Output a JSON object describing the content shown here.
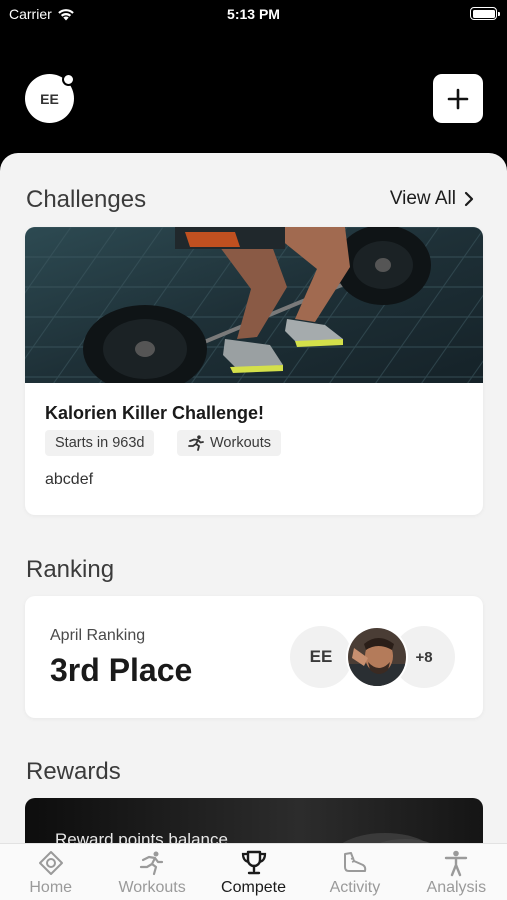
{
  "status_bar": {
    "carrier": "Carrier",
    "time": "5:13 PM"
  },
  "header": {
    "avatar_initials": "EE"
  },
  "challenges": {
    "title": "Challenges",
    "view_all": "View All",
    "card": {
      "title": "Kalorien Killer Challenge!",
      "chip_start": "Starts in 963d",
      "chip_type": "Workouts",
      "description": "abcdef"
    }
  },
  "ranking": {
    "title": "Ranking",
    "label": "April Ranking",
    "value": "3rd Place",
    "avatar_initials": "EE",
    "more_count": "+8"
  },
  "rewards": {
    "title": "Rewards",
    "balance_label": "Reward points balance"
  },
  "tab_bar": {
    "items": [
      {
        "label": "Home",
        "icon": "home-icon"
      },
      {
        "label": "Workouts",
        "icon": "running-icon"
      },
      {
        "label": "Compete",
        "icon": "trophy-icon"
      },
      {
        "label": "Activity",
        "icon": "shoe-icon"
      },
      {
        "label": "Analysis",
        "icon": "person-icon"
      }
    ],
    "active": "Compete"
  },
  "colors": {
    "header_bg": "#000000",
    "sheet_bg": "#f3f3f3",
    "active_tab": "#1a1a1a",
    "inactive_tab": "#9a9a9a"
  }
}
